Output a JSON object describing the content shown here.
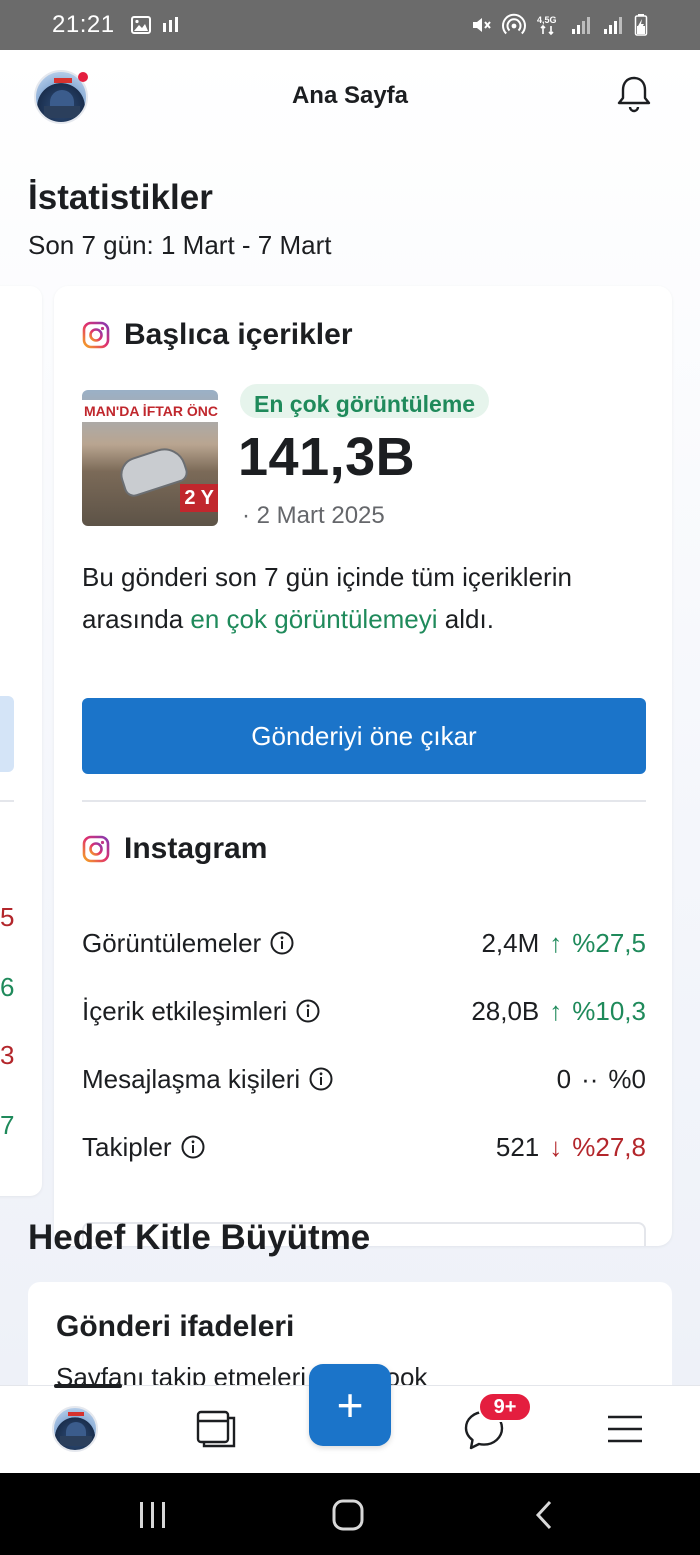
{
  "status_bar": {
    "time": "21:21",
    "left_icons": [
      "gallery-icon",
      "signal-bars-icon"
    ],
    "right_icons": [
      "mute-icon",
      "hotspot-icon",
      "network-4.5g-icon",
      "signal-1-icon",
      "signal-2-icon",
      "battery-charging-icon"
    ],
    "network_label": "4,5G"
  },
  "header": {
    "title": "Ana Sayfa"
  },
  "stats": {
    "title": "İstatistikler",
    "subtitle": "Son 7 gün: 1 Mart - 7 Mart",
    "left_peek_values": [
      {
        "text": "5",
        "tone": "red"
      },
      {
        "text": "6",
        "tone": "green"
      },
      {
        "text": "3",
        "tone": "red"
      },
      {
        "text": "7",
        "tone": "green"
      }
    ]
  },
  "top_content": {
    "title": "Başlıca içerikler",
    "thumbnail_banner": "MAN'DA İFTAR ÖNCESİ",
    "thumbnail_badge": "2 Y",
    "pill": "En çok görüntüleme",
    "value": "141,3B",
    "date": "· 2 Mart 2025",
    "desc_pre": "Bu gönderi son 7 gün içinde tüm içeriklerin arasında ",
    "desc_highlight": "en çok görüntülemeyi",
    "desc_post": " aldı.",
    "boost_label": "Gönderiyi öne çıkar"
  },
  "instagram": {
    "title": "Instagram",
    "metrics": [
      {
        "label": "Görüntülemeler",
        "value": "2,4M",
        "arrow": "↑",
        "change": "%27,5",
        "trend": "up"
      },
      {
        "label": "İçerik etkileşimleri",
        "value": "28,0B",
        "arrow": "↑",
        "change": "%10,3",
        "trend": "up"
      },
      {
        "label": "Mesajlaşma kişileri",
        "value": "0",
        "arrow": "··",
        "change": "%0",
        "trend": "neutral"
      },
      {
        "label": "Takipler",
        "value": "521",
        "arrow": "↓",
        "change": "%27,8",
        "trend": "down"
      }
    ]
  },
  "audience": {
    "title": "Hedef Kitle Büyütme",
    "card_title": "Gönderi ifadeleri",
    "card_text": "Sayfanı takip etmeleri      Facebook"
  },
  "tab_bar": {
    "fab_label": "+",
    "messages_badge": "9+"
  },
  "colors": {
    "brand_blue": "#1b74c9",
    "positive_green": "#1f8a5b",
    "negative_red": "#b3262b",
    "badge_red": "#e41e3f"
  }
}
